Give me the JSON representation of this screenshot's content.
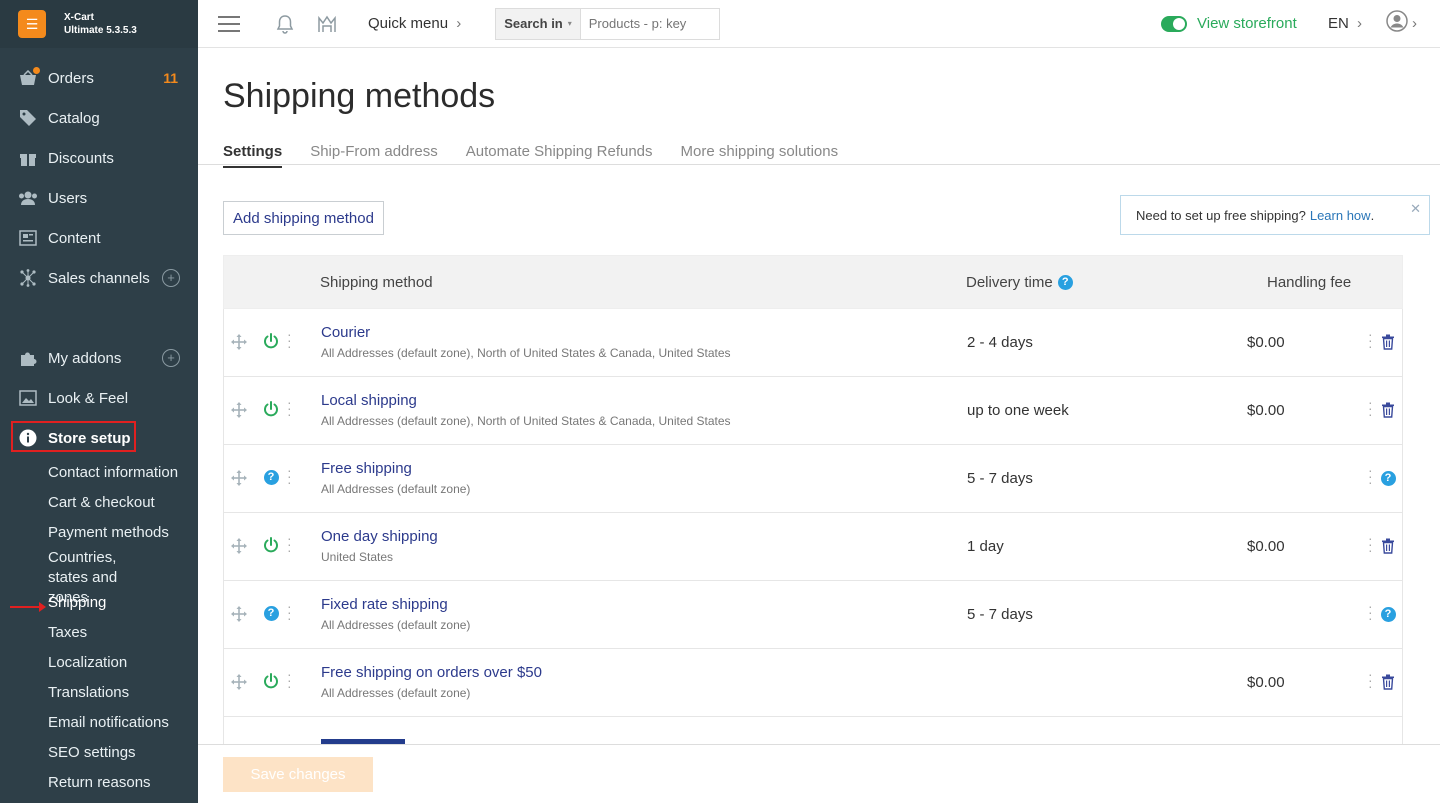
{
  "brand": {
    "logo_glyph": "☰",
    "name": "X-Cart",
    "version": "Ultimate 5.3.5.3"
  },
  "sidebar": {
    "items": [
      {
        "label": "Orders",
        "icon": "orders-icon",
        "count": "11"
      },
      {
        "label": "Catalog",
        "icon": "tag-icon"
      },
      {
        "label": "Discounts",
        "icon": "gift-icon"
      },
      {
        "label": "Users",
        "icon": "users-icon"
      },
      {
        "label": "Content",
        "icon": "newspaper-icon"
      },
      {
        "label": "Sales channels",
        "icon": "network-icon",
        "plus": "+"
      },
      {
        "label": "My addons",
        "icon": "puzzle-icon",
        "plus": "+"
      },
      {
        "label": "Look & Feel",
        "icon": "image-icon"
      },
      {
        "label": "Store setup",
        "icon": "info-icon"
      }
    ],
    "subitems": [
      "Contact information",
      "Cart & checkout",
      "Payment methods",
      "Countries, states and zones",
      "Shipping",
      "Taxes",
      "Localization",
      "Translations",
      "Email notifications",
      "SEO settings",
      "Return reasons"
    ],
    "current_subitem": "Shipping"
  },
  "header": {
    "quick_menu": "Quick menu",
    "quick_menu_chevron": "›",
    "search_in": "Search in",
    "search_caret": "▾",
    "search_placeholder": "Products - p: key",
    "view_storefront": "View storefront",
    "lang": "EN",
    "lang_chevron": "›",
    "user_chevron": "›"
  },
  "page": {
    "title": "Shipping methods",
    "tabs": [
      "Settings",
      "Ship-From address",
      "Automate Shipping Refunds",
      "More shipping solutions"
    ],
    "add_button": "Add shipping method",
    "notice_text": "Need to set up free shipping?",
    "notice_link": "Learn how",
    "notice_period": ".",
    "notice_close": "✕"
  },
  "table": {
    "columns": {
      "method": "Shipping method",
      "delivery": "Delivery time",
      "fee": "Handling fee"
    },
    "help_glyph": "?",
    "rows": [
      {
        "name": "Courier",
        "zone": "All Addresses (default zone), North of United States & Canada, United States",
        "delivery": "2 - 4 days",
        "fee": "$0.00",
        "status": "power",
        "action": "trash"
      },
      {
        "name": "Local shipping",
        "zone": "All Addresses (default zone), North of United States & Canada, United States",
        "delivery": "up to one week",
        "fee": "$0.00",
        "status": "power",
        "action": "trash"
      },
      {
        "name": "Free shipping",
        "zone": "All Addresses (default zone)",
        "delivery": "5 - 7 days",
        "fee": "",
        "status": "help",
        "action": "help"
      },
      {
        "name": "One day shipping",
        "zone": "United States",
        "delivery": "1 day",
        "fee": "$0.00",
        "status": "power",
        "action": "trash"
      },
      {
        "name": "Fixed rate shipping",
        "zone": "All Addresses (default zone)",
        "delivery": "5 - 7 days",
        "fee": "",
        "status": "help",
        "action": "help"
      },
      {
        "name": "Free shipping on orders over $50",
        "zone": "All Addresses (default zone)",
        "delivery": "",
        "fee": "$0.00",
        "status": "power",
        "action": "trash"
      }
    ]
  },
  "footer": {
    "save_button": "Save changes"
  },
  "colors": {
    "sidebar_bg": "#2e3f48",
    "accent_orange": "#f48a1c",
    "link_blue": "#2c3a8c",
    "green": "#2aaa5b",
    "help_blue": "#29a0e0",
    "annotation_red": "#e02020"
  }
}
